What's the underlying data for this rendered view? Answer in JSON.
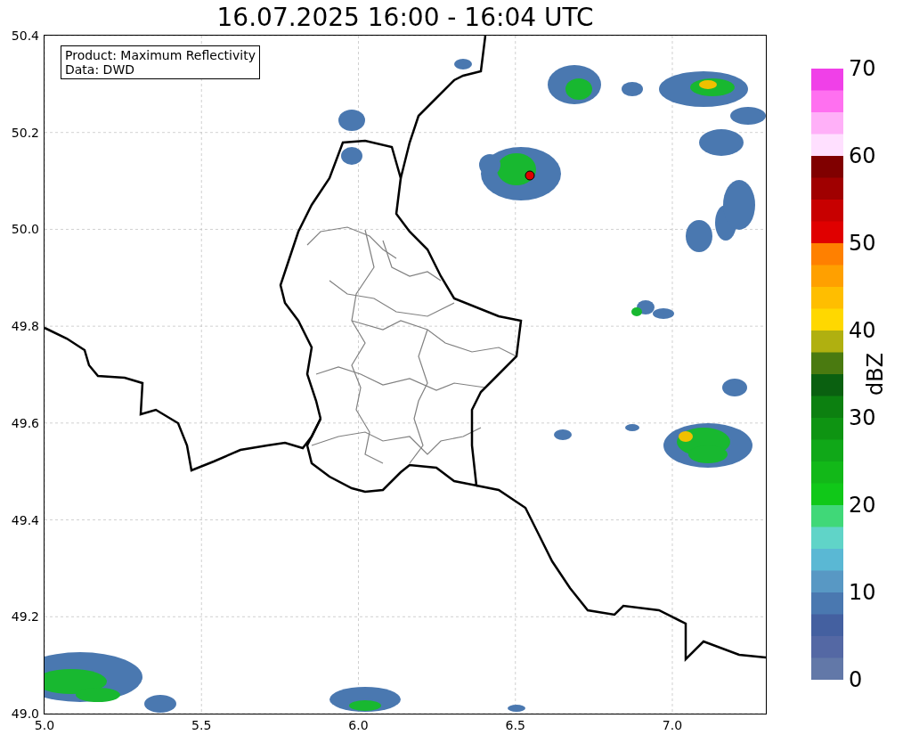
{
  "title": "16.07.2025 16:00 - 16:04 UTC",
  "legend": {
    "lines": [
      "Product: Maximum Reflectivity",
      "Data: DWD"
    ]
  },
  "map": {
    "x_ticks": [
      "5.0",
      "5.5",
      "6.0",
      "6.5",
      "7.0"
    ],
    "y_ticks": [
      "50.4",
      "50.2",
      "50.0",
      "49.8",
      "49.6",
      "49.4",
      "49.2",
      "49.0"
    ]
  },
  "colorbar": {
    "label": "dBZ",
    "ticks": [
      "70",
      "60",
      "50",
      "40",
      "30",
      "20",
      "10",
      "0"
    ],
    "bands": [
      {
        "color": "#f040e8"
      },
      {
        "color": "#ff70f0"
      },
      {
        "color": "#ffb0f8"
      },
      {
        "color": "#ffe0ff"
      },
      {
        "color": "#800000"
      },
      {
        "color": "#a00000"
      },
      {
        "color": "#c80000"
      },
      {
        "color": "#e00000"
      },
      {
        "color": "#ff8000"
      },
      {
        "color": "#ffa000"
      },
      {
        "color": "#ffbe00"
      },
      {
        "color": "#ffd800"
      },
      {
        "color": "#b0b010"
      },
      {
        "color": "#4a7a10"
      },
      {
        "color": "#0a6010"
      },
      {
        "color": "#0c8010"
      },
      {
        "color": "#0e9412"
      },
      {
        "color": "#10a818"
      },
      {
        "color": "#12b818"
      },
      {
        "color": "#10c818"
      },
      {
        "color": "#40d878"
      },
      {
        "color": "#60d4c8"
      },
      {
        "color": "#5ab8d4"
      },
      {
        "color": "#5898c4"
      },
      {
        "color": "#4a78b0"
      },
      {
        "color": "#4460a0"
      },
      {
        "color": "#5468a4"
      },
      {
        "color": "#6278a8"
      }
    ]
  }
}
